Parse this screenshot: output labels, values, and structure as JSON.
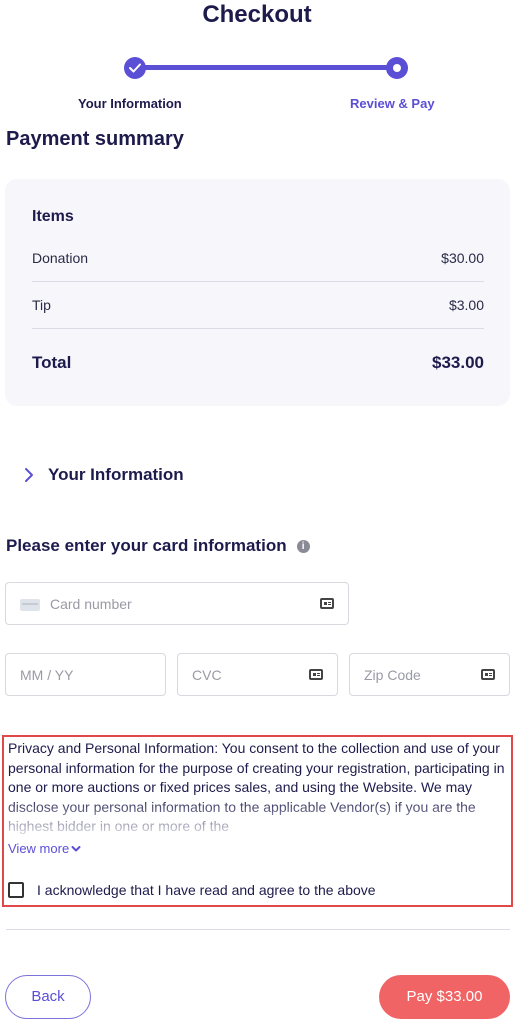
{
  "header": {
    "title": "Checkout"
  },
  "stepper": {
    "steps": [
      {
        "label": "Your Information",
        "state": "completed",
        "icon": "check-icon"
      },
      {
        "label": "Review & Pay",
        "state": "current"
      }
    ],
    "accent": "#5b4fd6"
  },
  "summary": {
    "heading": "Payment summary",
    "items_heading": "Items",
    "rows": [
      {
        "label": "Donation",
        "amount": "$30.00"
      },
      {
        "label": "Tip",
        "amount": "$3.00"
      }
    ],
    "total": {
      "label": "Total",
      "amount": "$33.00"
    }
  },
  "your_information": {
    "label": "Your Information",
    "icon": "chevron-right-icon"
  },
  "card": {
    "heading": "Please enter your card information",
    "info_icon": "info-icon",
    "card_number_placeholder": "Card number",
    "expiry_placeholder": "MM / YY",
    "cvc_placeholder": "CVC",
    "zip_placeholder": "Zip Code"
  },
  "consent": {
    "text": "Privacy and Personal Information: You consent to the collection and use of your personal information for the purpose of creating your registration, participating in one or more auctions or fixed prices sales, and using the Website. We may disclose your personal information to the applicable Vendor(s) if you are the highest bidder in one or more of the",
    "view_more": "View more",
    "acknowledge": "I acknowledge that I have read and agree to the above",
    "checked": false
  },
  "footer": {
    "back_label": "Back",
    "pay_label": "Pay $33.00",
    "pay_color": "#f06465"
  }
}
